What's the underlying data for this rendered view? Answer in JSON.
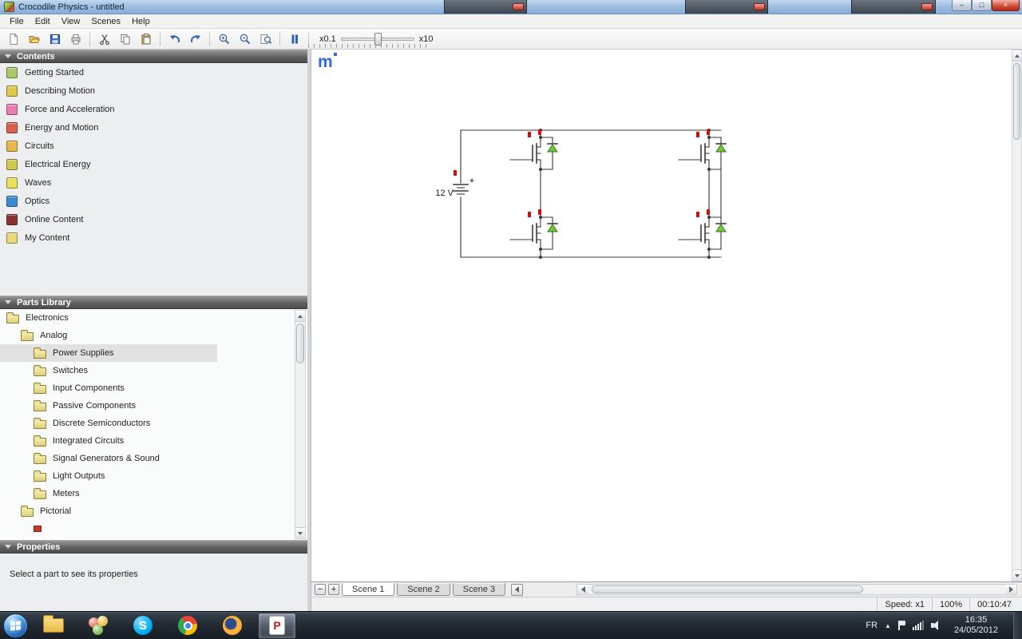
{
  "window": {
    "title": "Crocodile Physics - untitled",
    "controls": {
      "minimize": "–",
      "maximize": "□",
      "close": "×"
    }
  },
  "menubar": {
    "items": [
      "File",
      "Edit",
      "View",
      "Scenes",
      "Help"
    ]
  },
  "toolbar": {
    "zoom_min_label": "x0.1",
    "zoom_max_label": "x10"
  },
  "contents": {
    "header": "Contents",
    "items": [
      {
        "label": "Getting Started",
        "color": "#a8c86a"
      },
      {
        "label": "Describing Motion",
        "color": "#e0c84a"
      },
      {
        "label": "Force and Acceleration",
        "color": "#e87fae"
      },
      {
        "label": "Energy and Motion",
        "color": "#d8604a"
      },
      {
        "label": "Circuits",
        "color": "#e8b84a"
      },
      {
        "label": "Electrical Energy",
        "color": "#d0c84a"
      },
      {
        "label": "Waves",
        "color": "#e8e05a"
      },
      {
        "label": "Optics",
        "color": "#3a8ad0"
      },
      {
        "label": "Online Content",
        "color": "#8a3030"
      },
      {
        "label": "My Content",
        "color": "#ead87a"
      }
    ]
  },
  "parts_library": {
    "header": "Parts Library",
    "tree": [
      {
        "label": "Electronics"
      },
      {
        "label": "Analog"
      },
      {
        "label": "Power Supplies"
      },
      {
        "label": "Switches"
      },
      {
        "label": "Input Components"
      },
      {
        "label": "Passive Components"
      },
      {
        "label": "Discrete Semiconductors"
      },
      {
        "label": "Integrated Circuits"
      },
      {
        "label": "Signal Generators & Sound"
      },
      {
        "label": "Light Outputs"
      },
      {
        "label": "Meters"
      },
      {
        "label": "Pictorial"
      }
    ]
  },
  "properties": {
    "header": "Properties",
    "message": "Select a part to see its properties"
  },
  "canvas": {
    "logo": "m",
    "battery_label": "12 V",
    "colors": {
      "wire": "#3a3a3a",
      "diode_green": "#72c63a",
      "indicator_red": "#cc1111",
      "logo_blue": "#2f6bd8"
    }
  },
  "scenes": {
    "remove_label": "−",
    "add_label": "+",
    "tabs": [
      "Scene 1",
      "Scene 2",
      "Scene 3"
    ]
  },
  "statusbar": {
    "speed": "Speed: x1",
    "zoom": "100%",
    "timer": "00:10:47"
  },
  "taskbar": {
    "language": "FR",
    "tray_chevron": "▲",
    "time": "16:35",
    "date": "24/05/2012",
    "skype_letter": "S",
    "p_app_letter": "P"
  }
}
